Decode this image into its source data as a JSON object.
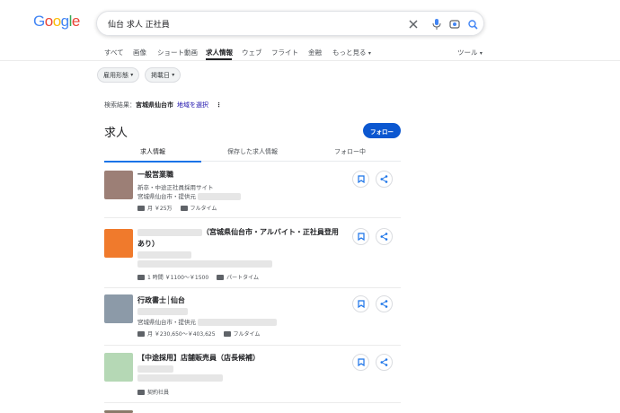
{
  "logo": {
    "letters": [
      "G",
      "o",
      "o",
      "g",
      "l",
      "e"
    ],
    "colors": [
      "#4285F4",
      "#EA4335",
      "#FBBC05",
      "#4285F4",
      "#34A853",
      "#EA4335"
    ]
  },
  "search": {
    "query": "仙台 求人 正社員"
  },
  "tabs": [
    {
      "label": "すべて"
    },
    {
      "label": "画像"
    },
    {
      "label": "ショート動画"
    },
    {
      "label": "求人情報"
    },
    {
      "label": "ウェブ"
    },
    {
      "label": "フライト"
    },
    {
      "label": "金融"
    },
    {
      "label": "もっと見る"
    },
    {
      "label": "ツール"
    }
  ],
  "filters": {
    "employment_type": "雇用形態",
    "posted_date": "掲載日"
  },
  "location": {
    "prefix": "検索結果：",
    "place": "宮城県仙台市",
    "change_link": "地域を選択"
  },
  "jobs_panel": {
    "title": "求人",
    "follow_label": "フォロー",
    "subtabs": [
      "求人情報",
      "保存した求人情報",
      "フォロー中"
    ]
  },
  "jobs": [
    {
      "title": "一般営業職",
      "line1": "新卒・中途正社員採用サイト",
      "line2": "宮城県仙台市・提供元",
      "salary": "月 ￥25万",
      "type": "フルタイム",
      "thumb_color": "#9c7f76"
    },
    {
      "title_tail": "（宮城県仙台市・アルバイト・正社員登用",
      "title_line2": "あり）",
      "salary": "1 時間 ￥1100～￥1500",
      "type": "パートタイム",
      "thumb_color": "#f07a2c"
    },
    {
      "title": "行政書士│仙台",
      "line2": "宮城県仙台市・提供元",
      "salary": "月 ￥230,650～￥403,625",
      "type": "フルタイム",
      "thumb_color": "#8c9aa8"
    },
    {
      "title": "【中途採用】店舗販売員（店長候補）",
      "type": "契約社員",
      "thumb_color": "#b5d8b5"
    }
  ]
}
